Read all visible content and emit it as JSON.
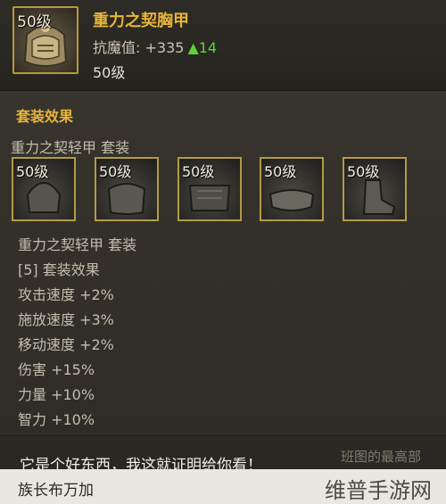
{
  "item": {
    "level_badge": "50级",
    "name": "重力之契胸甲",
    "stat_label": "抗魔值: +335",
    "stat_increase": "▲14",
    "level_text": "50级"
  },
  "set_section": {
    "title": "套装效果",
    "set_name": "重力之契轻甲 套装",
    "pieces": [
      {
        "level": "50级"
      },
      {
        "level": "50级"
      },
      {
        "level": "50级"
      },
      {
        "level": "50级"
      },
      {
        "level": "50级"
      }
    ],
    "set_name_repeat": "重力之契轻甲 套装",
    "bonus_header": "[5] 套装效果",
    "bonuses": [
      "攻击速度 +2%",
      "施放速度 +3%",
      "移动速度 +2%",
      "伤害 +15%",
      "力量 +10%",
      "智力 +10%"
    ]
  },
  "dialog": {
    "text": "它是个好东西，我这就证明给你看！",
    "faded_text": "班图的最高部"
  },
  "footer": {
    "speaker": "族长布万加",
    "watermark": "维普手游网"
  },
  "colors": {
    "gold_title": "#e8b43a",
    "stat_up": "#5dd33b",
    "slot_border": "#b39a48"
  }
}
